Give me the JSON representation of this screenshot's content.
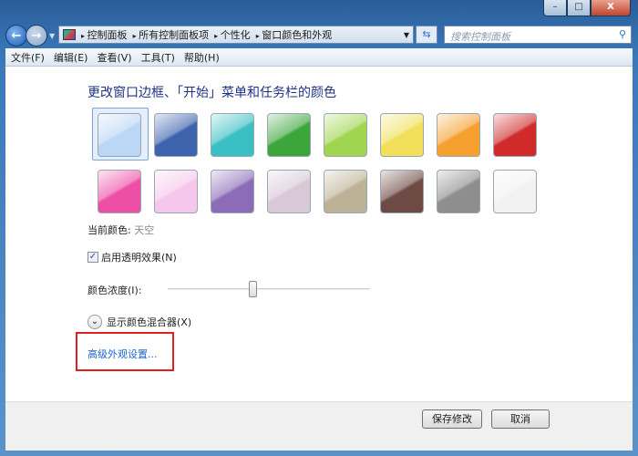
{
  "window": {
    "minimize": "–",
    "maximize": "□",
    "close": "X"
  },
  "breadcrumb": [
    "控制面板",
    "所有控制面板项",
    "个性化",
    "窗口颜色和外观"
  ],
  "search": {
    "placeholder": "搜索控制面板"
  },
  "menu": [
    "文件(F)",
    "编辑(E)",
    "查看(V)",
    "工具(T)",
    "帮助(H)"
  ],
  "main": {
    "title": "更改窗口边框、「开始」菜单和任务栏的颜色",
    "swatches": [
      {
        "name": "天空",
        "color": "#bcd7f5",
        "selected": true
      },
      {
        "color": "#3e63ad"
      },
      {
        "color": "#39bfc4"
      },
      {
        "color": "#3ca63c"
      },
      {
        "color": "#9fd54f"
      },
      {
        "color": "#f2e05a"
      },
      {
        "color": "#f6a030"
      },
      {
        "color": "#d02a2a"
      },
      {
        "color": "#ee4fa6"
      },
      {
        "color": "#f6c7ec"
      },
      {
        "color": "#8c6cb8"
      },
      {
        "color": "#d8c8d8"
      },
      {
        "color": "#bdb295"
      },
      {
        "color": "#6e4a45"
      },
      {
        "color": "#8e8e8e"
      },
      {
        "color": "#f2f2f2"
      }
    ],
    "current_label": "当前颜色:",
    "current_value": "天空",
    "transparency_label": "启用透明效果(N)",
    "transparency_checked": true,
    "intensity_label": "颜色浓度(I):",
    "intensity_percent": 42,
    "mixer_label": "显示颜色混合器(X)",
    "advanced_link": "高级外观设置..."
  },
  "footer": {
    "save": "保存修改",
    "cancel": "取消"
  }
}
